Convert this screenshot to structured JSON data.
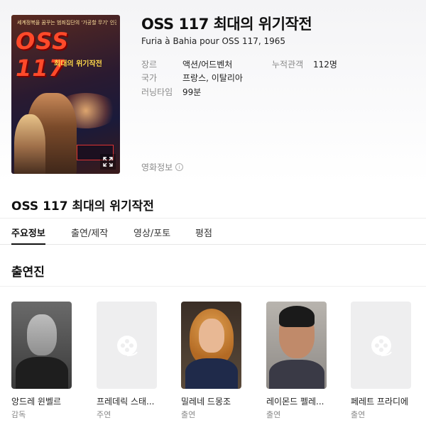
{
  "movie": {
    "title": "OSS 117 최대의 위기작전",
    "original_title": "Furia à Bahia pour OSS 117, 1965",
    "poster": {
      "tagline": "세계정복을 꿈꾸는 범죄집단의 '가공할 무기' 인간폭탄!",
      "title": "OSS 117",
      "subtitle": "최대의 위기작전"
    },
    "meta": [
      {
        "key": "장르",
        "value": "액션/어드벤처"
      },
      {
        "key": "국가",
        "value": "프랑스, 이탈리아"
      },
      {
        "key": "러닝타임",
        "value": "99분"
      }
    ],
    "audience": {
      "key": "누적관객",
      "value": "112명"
    },
    "info_link": "영화정보"
  },
  "section_title": "OSS 117 최대의 위기작전",
  "tabs": [
    "주요정보",
    "출연/제작",
    "영상/포토",
    "평점"
  ],
  "active_tab": "주요정보",
  "cast_title": "출연진",
  "cast": [
    {
      "name": "앙드레 윈벨르",
      "role": "감독",
      "photo": "portrait"
    },
    {
      "name": "프레데릭 스태...",
      "role": "주연",
      "photo": "film-reel-icon"
    },
    {
      "name": "밀레네 드몽조",
      "role": "출연",
      "photo": "portrait"
    },
    {
      "name": "레이몬드 펠레...",
      "role": "출연",
      "photo": "portrait"
    },
    {
      "name": "페레트 프라디에",
      "role": "출연",
      "photo": "film-reel-icon"
    }
  ],
  "colors": {
    "active_tab_underline": "#111111",
    "muted_text": "#8a8a8a",
    "placeholder_bg": "#eeeeef"
  }
}
